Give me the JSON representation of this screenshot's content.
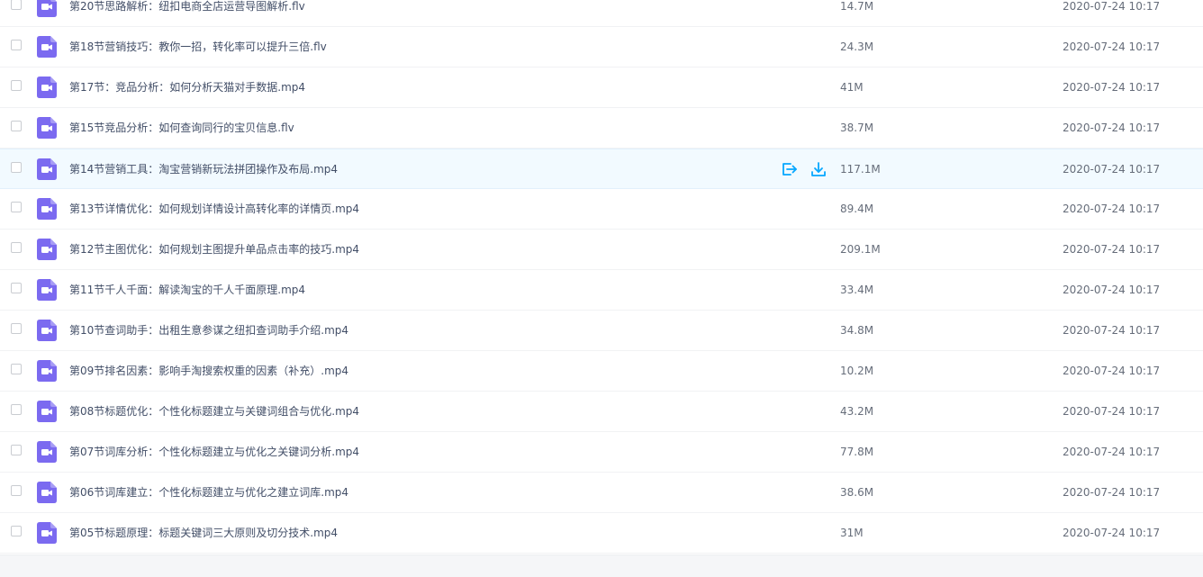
{
  "colors": {
    "icon_purple": "#7b6af0",
    "action_blue": "#06a7ff",
    "hover_row": "#f2faff"
  },
  "files": [
    {
      "name": "第20节思路解析：纽扣电商全店运营导图解析.flv",
      "size": "14.7M",
      "date": "2020-07-24 10:17",
      "type_icon": "video-file-icon"
    },
    {
      "name": "第18节营销技巧：教你一招，转化率可以提升三倍.flv",
      "size": "24.3M",
      "date": "2020-07-24 10:17",
      "type_icon": "video-file-icon"
    },
    {
      "name": "第17节：竞品分析：如何分析天猫对手数据.mp4",
      "size": "41M",
      "date": "2020-07-24 10:17",
      "type_icon": "video-file-icon"
    },
    {
      "name": "第15节竞品分析：如何查询同行的宝贝信息.flv",
      "size": "38.7M",
      "date": "2020-07-24 10:17",
      "type_icon": "video-file-icon"
    },
    {
      "name": "第14节营销工具：淘宝营销新玩法拼团操作及布局.mp4",
      "size": "117.1M",
      "date": "2020-07-24 10:17",
      "type_icon": "video-file-icon",
      "hovered": true
    },
    {
      "name": "第13节详情优化：如何规划详情设计高转化率的详情页.mp4",
      "size": "89.4M",
      "date": "2020-07-24 10:17",
      "type_icon": "video-file-icon"
    },
    {
      "name": "第12节主图优化：如何规划主图提升单品点击率的技巧.mp4",
      "size": "209.1M",
      "date": "2020-07-24 10:17",
      "type_icon": "video-file-icon"
    },
    {
      "name": "第11节千人千面：解读淘宝的千人千面原理.mp4",
      "size": "33.4M",
      "date": "2020-07-24 10:17",
      "type_icon": "video-file-icon"
    },
    {
      "name": "第10节查词助手：出租生意参谋之纽扣查词助手介绍.mp4",
      "size": "34.8M",
      "date": "2020-07-24 10:17",
      "type_icon": "video-file-icon"
    },
    {
      "name": "第09节排名因素：影响手淘搜索权重的因素（补充）.mp4",
      "size": "10.2M",
      "date": "2020-07-24 10:17",
      "type_icon": "video-file-icon"
    },
    {
      "name": "第08节标题优化：个性化标题建立与关键词组合与优化.mp4",
      "size": "43.2M",
      "date": "2020-07-24 10:17",
      "type_icon": "video-file-icon"
    },
    {
      "name": "第07节词库分析：个性化标题建立与优化之关键词分析.mp4",
      "size": "77.8M",
      "date": "2020-07-24 10:17",
      "type_icon": "video-file-icon"
    },
    {
      "name": "第06节词库建立：个性化标题建立与优化之建立词库.mp4",
      "size": "38.6M",
      "date": "2020-07-24 10:17",
      "type_icon": "video-file-icon"
    },
    {
      "name": "第05节标题原理：标题关键词三大原则及切分技术.mp4",
      "size": "31M",
      "date": "2020-07-24 10:17",
      "type_icon": "video-file-icon"
    }
  ],
  "row_actions": {
    "share_icon": "share-icon",
    "download_icon": "download-icon"
  }
}
